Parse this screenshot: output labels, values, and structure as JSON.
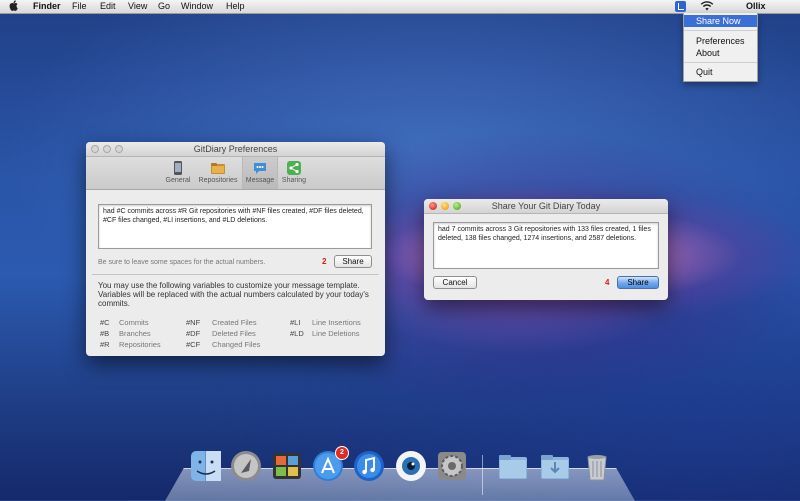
{
  "menubar": {
    "apple": "",
    "app_name": "Finder",
    "menus": [
      "File",
      "Edit",
      "View",
      "Go",
      "Window",
      "Help"
    ],
    "user": "Ollix"
  },
  "status_menu": {
    "items": [
      "Share Now",
      "Preferences",
      "About",
      "Quit"
    ],
    "active_index": 0
  },
  "prefs_window": {
    "title": "GitDiary Preferences",
    "tabs": [
      {
        "label": "General",
        "icon": "phone-icon"
      },
      {
        "label": "Repositories",
        "icon": "folder-icon"
      },
      {
        "label": "Message",
        "icon": "speech-bubble-icon"
      },
      {
        "label": "Sharing",
        "icon": "share-icon"
      }
    ],
    "selected_tab": "Message",
    "message_text": "had #C commits across #R Git repositories with #NF files created, #DF files deleted, #CF files changed, #LI insertions, and #LD deletions.",
    "hint": "Be sure to leave some spaces for the actual numbers.",
    "marker": "2",
    "share_button": "Share",
    "info": "You may use the following variables to customize your message template. Variables will be replaced with the actual numbers calculated by your today's commits.",
    "variables": [
      {
        "code": "#C",
        "desc": "Commits"
      },
      {
        "code": "#B",
        "desc": "Branches"
      },
      {
        "code": "#R",
        "desc": "Repositories"
      },
      {
        "code": "#NF",
        "desc": "Created Files"
      },
      {
        "code": "#DF",
        "desc": "Deleted Files"
      },
      {
        "code": "#CF",
        "desc": "Changed Files"
      },
      {
        "code": "#LI",
        "desc": "Line Insertions"
      },
      {
        "code": "#LD",
        "desc": "Line Deletions"
      }
    ]
  },
  "share_window": {
    "title": "Share Your Git Diary Today",
    "message_text": "had 7 commits across 3 Git repositories with 133 files created, 1 files deleted, 138 files changed, 1274 insertions, and 2587 deletions.",
    "cancel_button": "Cancel",
    "marker": "4",
    "share_button": "Share"
  },
  "dock": {
    "app_store_badge": "2"
  },
  "colors": {
    "menu_highlight": "#3a6fd8",
    "marker_red": "#d4211b",
    "default_button": "#6fa8ec"
  }
}
